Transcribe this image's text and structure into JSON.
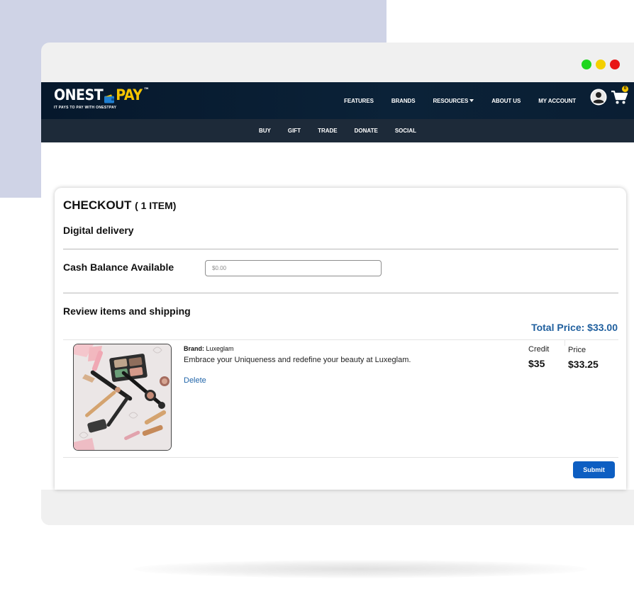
{
  "brand": {
    "logo_left": "ONEST",
    "logo_right": "PAY",
    "trademark": "™",
    "tagline": "IT PAYS TO PAY WITH ONESTPAY",
    "accent_color": "#f5c400"
  },
  "top_nav": {
    "items": [
      {
        "label": "FEATURES"
      },
      {
        "label": "BRANDS"
      },
      {
        "label": "RESOURCES"
      },
      {
        "label": "ABOUT US"
      },
      {
        "label": "MY ACCOUNT"
      }
    ],
    "cart_count": "0",
    "icons": [
      "account-icon",
      "cart-icon"
    ]
  },
  "sub_nav": {
    "items": [
      {
        "label": "BUY"
      },
      {
        "label": "GIFT"
      },
      {
        "label": "TRADE"
      },
      {
        "label": "DONATE"
      },
      {
        "label": "SOCIAL"
      }
    ]
  },
  "checkout": {
    "title": "CHECKOUT",
    "item_count": "( 1 ITEM)",
    "delivery_label": "Digital delivery",
    "cash_balance_label": "Cash Balance Available",
    "cash_balance_placeholder": "$0.00",
    "review_label": "Review items and shipping",
    "total_price": "Total Price: $33.00",
    "submit_label": "Submit"
  },
  "item": {
    "brand_label": "Brand:",
    "brand_name": "Luxeglam",
    "description": "Embrace your Uniqueness and redefine your beauty at Luxeglam.",
    "delete_label": "Delete",
    "credit_label": "Credit",
    "credit_value": "$35",
    "price_label": "Price",
    "price_value": "$33.25"
  },
  "window_controls": {
    "colors": [
      "#1fd61f",
      "#f4d000",
      "#e81616"
    ]
  }
}
